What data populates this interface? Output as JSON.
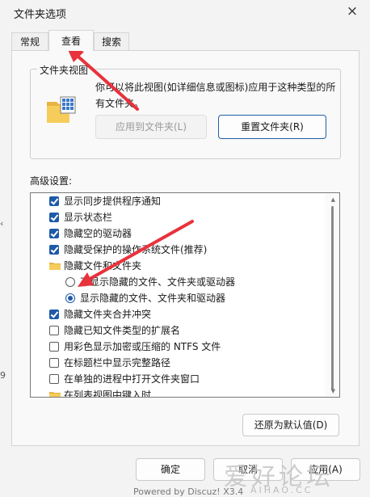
{
  "window": {
    "title": "文件夹选项",
    "close_icon": "×"
  },
  "tabs": [
    {
      "label": "常规",
      "selected": false
    },
    {
      "label": "查看",
      "selected": true
    },
    {
      "label": "搜索",
      "selected": false
    }
  ],
  "folder_views": {
    "title": "文件夹视图",
    "description": "你可以将此视图(如详细信息或图标)应用于这种类型的所有文件夹。",
    "apply_button": "应用到文件夹(L)",
    "reset_button": "重置文件夹(R)"
  },
  "advanced": {
    "label": "高级设置:",
    "items": [
      {
        "kind": "checkbox",
        "checked": true,
        "label": "显示同步提供程序通知"
      },
      {
        "kind": "checkbox",
        "checked": true,
        "label": "显示状态栏"
      },
      {
        "kind": "checkbox",
        "checked": true,
        "label": "隐藏空的驱动器"
      },
      {
        "kind": "checkbox",
        "checked": true,
        "label": "隐藏受保护的操作系统文件(推荐)"
      },
      {
        "kind": "folder",
        "label": "隐藏文件和文件夹"
      },
      {
        "kind": "radio",
        "checked": false,
        "label": "不显示隐藏的文件、文件夹或驱动器"
      },
      {
        "kind": "radio",
        "checked": true,
        "label": "显示隐藏的文件、文件夹和驱动器"
      },
      {
        "kind": "checkbox",
        "checked": true,
        "label": "隐藏文件夹合并冲突"
      },
      {
        "kind": "checkbox",
        "checked": false,
        "label": "隐藏已知文件类型的扩展名"
      },
      {
        "kind": "checkbox",
        "checked": false,
        "label": "用彩色显示加密或压缩的 NTFS 文件"
      },
      {
        "kind": "checkbox",
        "checked": false,
        "label": "在标题栏中显示完整路径"
      },
      {
        "kind": "checkbox",
        "checked": false,
        "label": "在单独的进程中打开文件夹窗口"
      },
      {
        "kind": "folder",
        "label": "在列表视图中键入时"
      }
    ],
    "restore_button": "还原为默认值(D)"
  },
  "footer": {
    "ok": "确定",
    "cancel": "取消",
    "apply": "应用(A)"
  },
  "fragments": {
    "left_1": "‹",
    "left_2": "9",
    "bottom": "Powered by Discuz! X3.4"
  },
  "watermark": {
    "text": "爱好论坛",
    "sub": "AIHAO.CC"
  },
  "colors": {
    "accent": "#1e5aa8",
    "annotation_arrow": "#e8323c"
  }
}
